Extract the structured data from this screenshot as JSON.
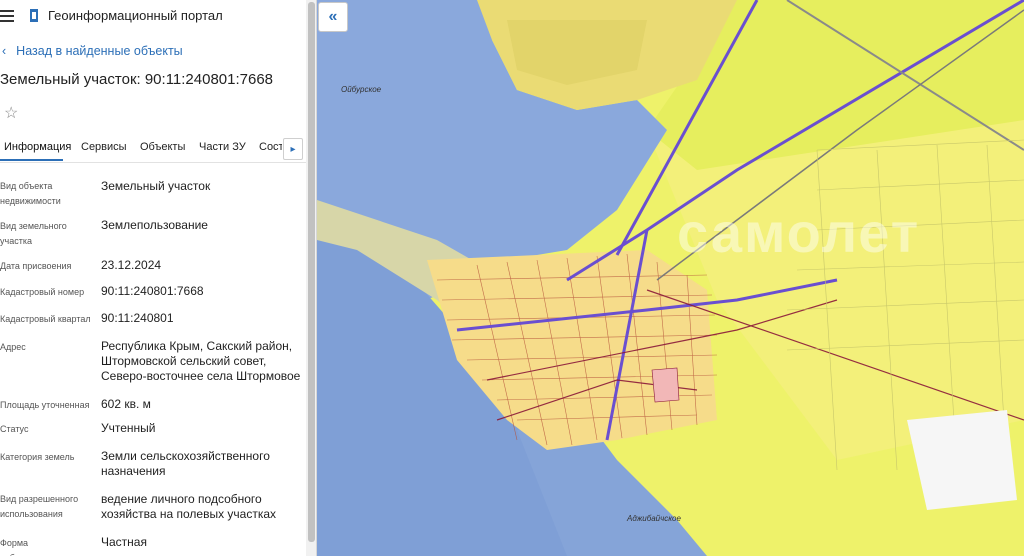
{
  "header": {
    "portal_title": "Геоинформационный портал",
    "menu_icon": "hamburger-icon",
    "logo_icon": "portal-logo-icon"
  },
  "nav": {
    "back_label": "Назад в найденные объекты"
  },
  "object": {
    "title": "Земельный участок: 90:11:240801:7668",
    "favorite_icon": "star-icon"
  },
  "tabs": [
    {
      "label": "Информация",
      "active": true
    },
    {
      "label": "Сервисы",
      "active": false
    },
    {
      "label": "Объекты",
      "active": false
    },
    {
      "label": "Части ЗУ",
      "active": false
    },
    {
      "label": "Состав",
      "active": false
    }
  ],
  "fields": [
    {
      "label": "Вид объекта недвижимости",
      "value": "Земельный участок"
    },
    {
      "label": "Вид земельного участка",
      "value": "Землепользование"
    },
    {
      "label": "Дата присвоения",
      "value": "23.12.2024"
    },
    {
      "label": "Кадастровый номер",
      "value": "90:11:240801:7668"
    },
    {
      "label": "Кадастровый квартал",
      "value": "90:11:240801"
    },
    {
      "label": "Адрес",
      "value": "Республика Крым, Сакский район, Штормовской сельский совет, Северо-восточнее села Штормовое"
    },
    {
      "label": "Площадь уточненная",
      "value": "602 кв. м"
    },
    {
      "label": "Статус",
      "value": "Учтенный"
    },
    {
      "label": "Категория земель",
      "value": "Земли сельскохозяйственного назначения"
    },
    {
      "label": "Вид разрешенного использования",
      "value": "ведение личного подсобного хозяйства на полевых участках"
    },
    {
      "label": "Форма собственности",
      "value": "Частная"
    }
  ],
  "map": {
    "labels": {
      "lake": "Ойбурское",
      "south": "Аджибайчское"
    },
    "watermark": "самолет",
    "colors": {
      "water": "#7f9fd6",
      "fields": "#eef26a",
      "parcels": "#f6dc8a",
      "roads": "#6a4fd0",
      "boundary": "#8b1a3a"
    }
  }
}
